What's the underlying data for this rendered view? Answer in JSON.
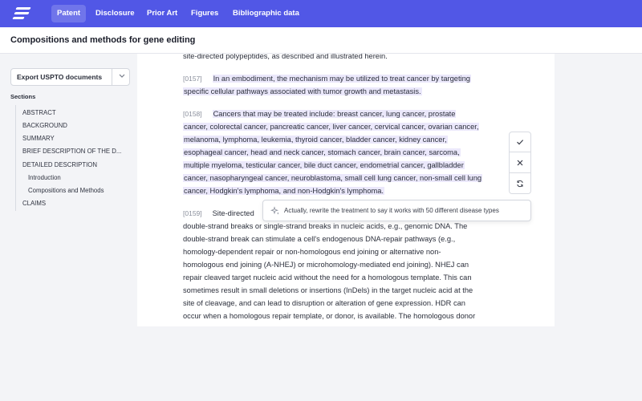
{
  "nav": {
    "tabs": [
      "Patent",
      "Disclosure",
      "Prior Art",
      "Figures",
      "Bibliographic data"
    ],
    "active": "Patent",
    "accent": "#5157e6"
  },
  "page_title": "Compositions and methods for gene editing",
  "sidebar": {
    "export_label": "Export USPTO documents",
    "sections_heading": "Sections",
    "sections": [
      {
        "label": "ABSTRACT"
      },
      {
        "label": "BACKGROUND"
      },
      {
        "label": "SUMMARY"
      },
      {
        "label": "BRIEF DESCRIPTION OF THE D..."
      },
      {
        "label": "DETAILED DESCRIPTION"
      },
      {
        "label": "Introduction"
      },
      {
        "label": "Compositions and Methods"
      },
      {
        "label": "CLAIMS"
      }
    ]
  },
  "document": {
    "lead_line": "site-directed polypeptides, as described and illustrated herein.",
    "p157": {
      "num": "[0157]",
      "lines": [
        "In an embodiment, the mechanism may be utilized to treat cancer by targeting",
        "specific cellular pathways associated with tumor growth and metastasis."
      ]
    },
    "p158": {
      "num": "[0158]",
      "lines": [
        "Cancers that may be treated include: breast cancer, lung cancer, prostate",
        "cancer, colorectal cancer, pancreatic cancer, liver cancer, cervical cancer, ovarian cancer,",
        "melanoma, lymphoma, leukemia, thyroid cancer, bladder cancer, kidney cancer,",
        "esophageal cancer, head and neck cancer, stomach cancer, brain cancer, sarcoma,",
        "multiple myeloma, testicular cancer, bile duct cancer, endometrial cancer, gallbladder",
        "cancer, nasopharyngeal cancer, neuroblastoma, small cell lung cancer, non-small cell lung",
        "cancer, Hodgkin's lymphoma, and non-Hodgkin's lymphoma."
      ]
    },
    "p159": {
      "num": "[0159]",
      "first": "Site-directed",
      "lines": [
        "double-strand breaks or single-strand breaks in nucleic acids, e.g., genomic DNA. The",
        "double-strand break can stimulate a cell's endogenous DNA-repair pathways (e.g.,",
        "homology-dependent repair or non-homologous end joining or alternative non-",
        "homologous end joining (A-NHEJ) or microhomology-mediated end joining). NHEJ can",
        "repair cleaved target nucleic acid without the need for a homologous template. This can",
        "sometimes result in small deletions or insertions (InDels) in the target nucleic acid at the",
        "site of cleavage, and can lead to disruption or alteration of gene expression. HDR can",
        "occur when a homologous repair template, or donor, is available. The homologous donor"
      ]
    }
  },
  "actions": {
    "accept_icon": "check-icon",
    "reject_icon": "close-icon",
    "regenerate_icon": "refresh-icon"
  },
  "prompt": {
    "icon": "sparkle-icon",
    "text": "Actually, rewrite the treatment to say it works with 50 different disease types"
  }
}
